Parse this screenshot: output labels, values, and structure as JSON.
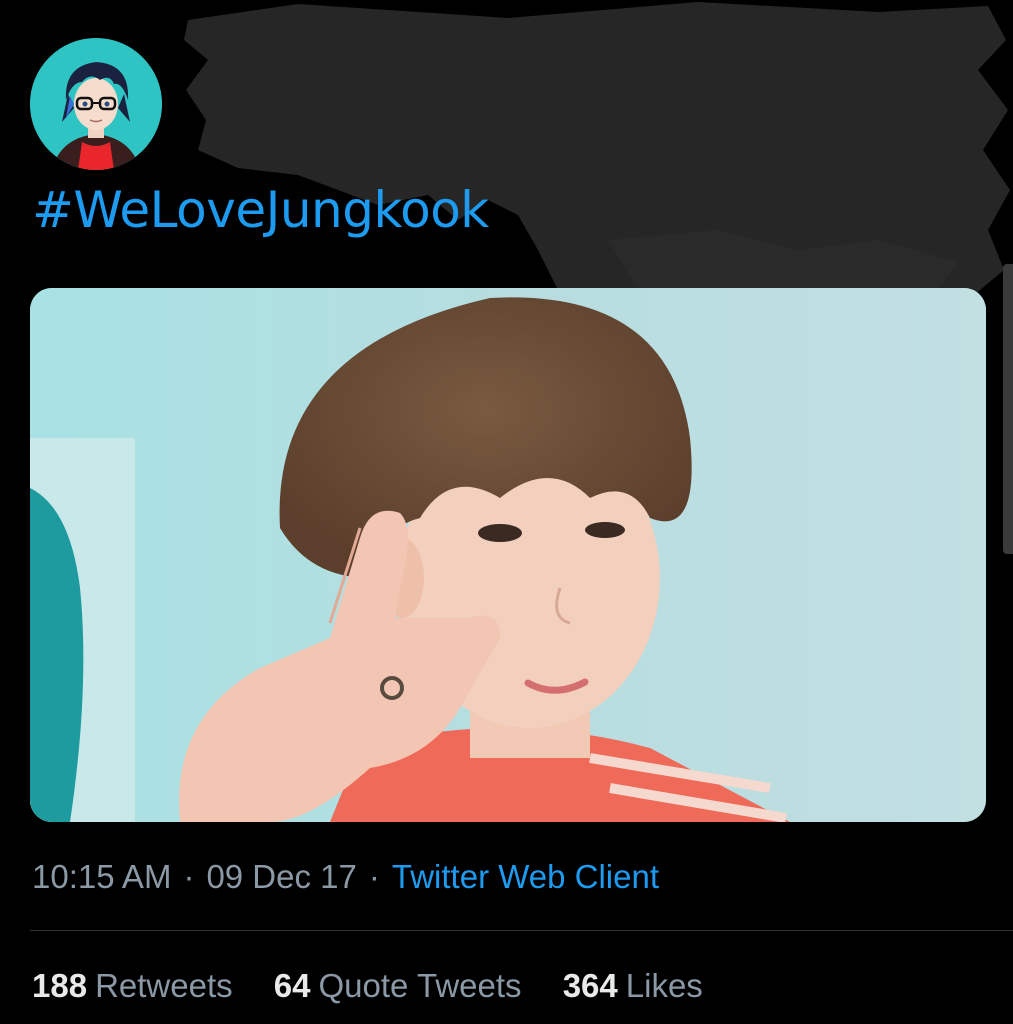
{
  "tweet": {
    "text": "#WeLoveJungkook",
    "time": "10:15 AM",
    "date": "09 Dec 17",
    "source": "Twitter Web Client",
    "separator": "·"
  },
  "stats": {
    "retweets_count": "188",
    "retweets_label": "Retweets",
    "quotes_count": "64",
    "quotes_label": "Quote Tweets",
    "likes_count": "364",
    "likes_label": "Likes"
  },
  "icons": {
    "avatar": "anime-avatar-glasses",
    "redaction": "black-scribble-redaction"
  },
  "colors": {
    "background": "#000000",
    "link": "#1d9bf0",
    "muted": "#8b98a5",
    "primary_text": "#e7e9ea",
    "avatar_bg": "#2fc4c4"
  }
}
